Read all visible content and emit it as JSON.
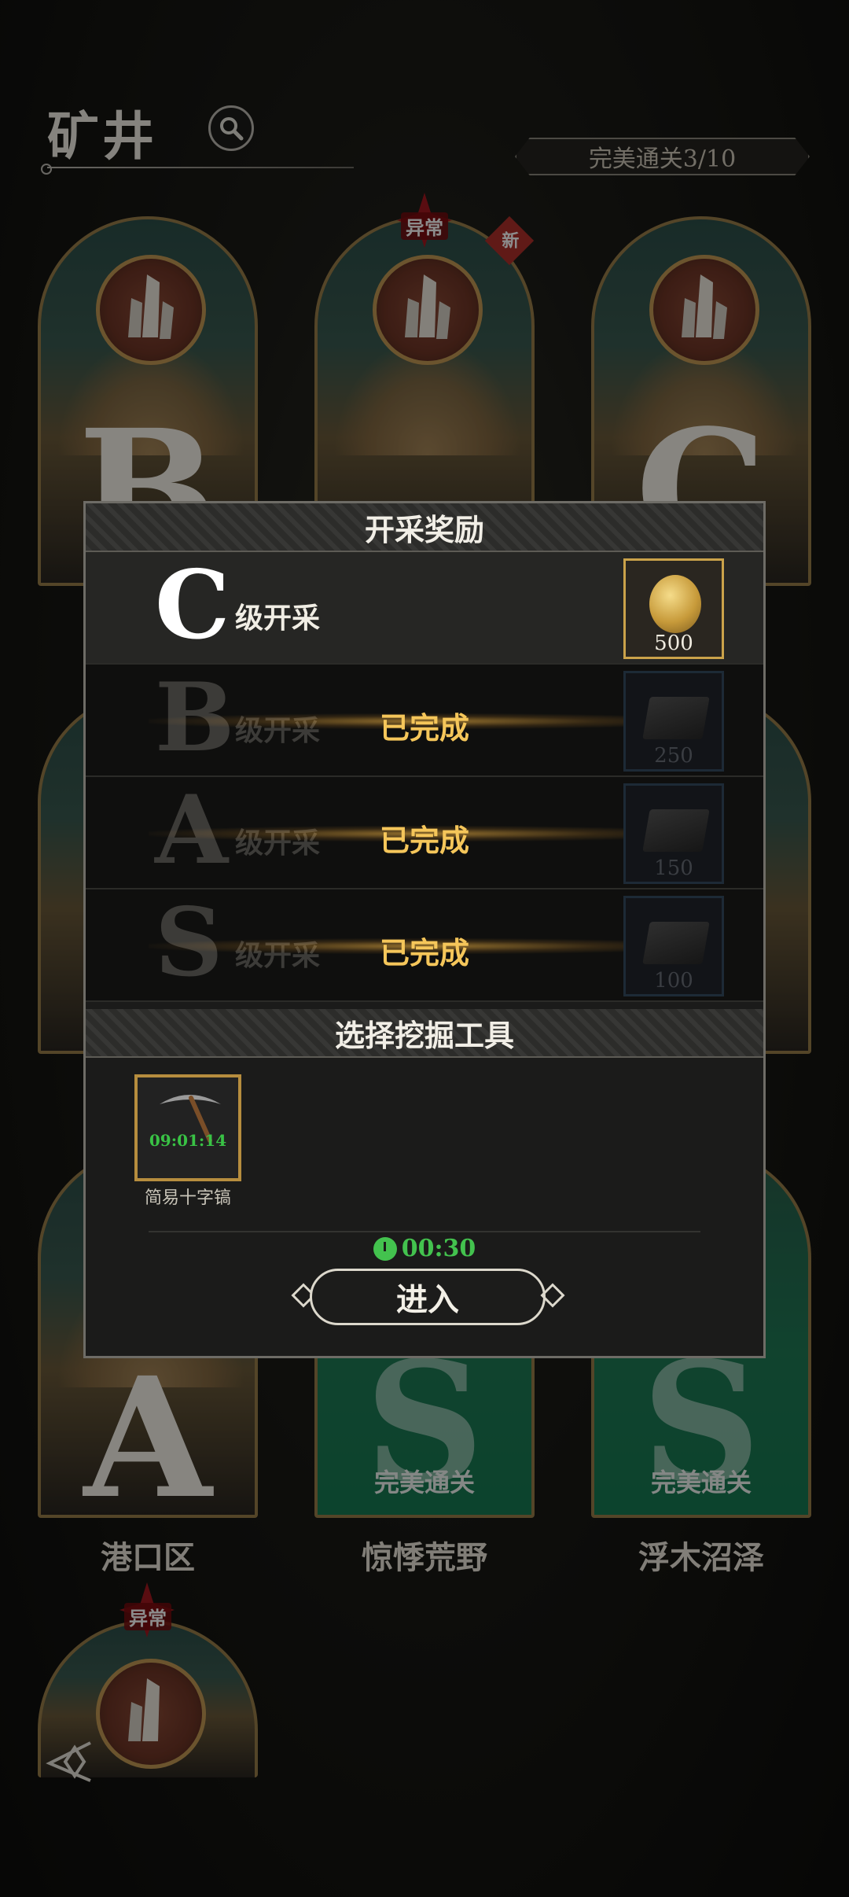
{
  "header": {
    "title": "矿井",
    "perfect_clear_counter": "完美通关3/10"
  },
  "mines": [
    {
      "grade": "B",
      "name": "",
      "status": ""
    },
    {
      "grade": "",
      "name": "",
      "marker": "异常",
      "badge": "新"
    },
    {
      "grade": "C",
      "name": "",
      "status": ""
    },
    {
      "grade": "A",
      "name": "港口区",
      "status": ""
    },
    {
      "grade": "S",
      "name": "惊悸荒野",
      "status": "完美通关"
    },
    {
      "grade": "S",
      "name": "浮木沼泽",
      "status": "完美通关"
    },
    {
      "grade": "",
      "name": "",
      "marker": "异常"
    }
  ],
  "modal": {
    "reward_title": "开采奖励",
    "rewards": [
      {
        "grade": "C",
        "label": "级开采",
        "state": "",
        "item_icon": "gold-coin-icon",
        "amount": "500"
      },
      {
        "grade": "B",
        "label": "级开采",
        "state": "已完成",
        "item_icon": "ingot-icon",
        "amount": "250"
      },
      {
        "grade": "A",
        "label": "级开采",
        "state": "已完成",
        "item_icon": "ingot-icon",
        "amount": "150"
      },
      {
        "grade": "S",
        "label": "级开采",
        "state": "已完成",
        "item_icon": "ingot-icon",
        "amount": "100"
      }
    ],
    "tool_title": "选择挖掘工具",
    "tool": {
      "name": "简易十字镐",
      "timer": "09:01:14",
      "icon": "pickaxe-icon"
    },
    "countdown": "00:30",
    "enter_label": "进入"
  },
  "colors": {
    "accent_gold": "#caa24a",
    "done_text": "#f5c65a",
    "timer_green": "#43c24e",
    "marker_red": "#a2191f",
    "perfect_green": "#167a52"
  }
}
